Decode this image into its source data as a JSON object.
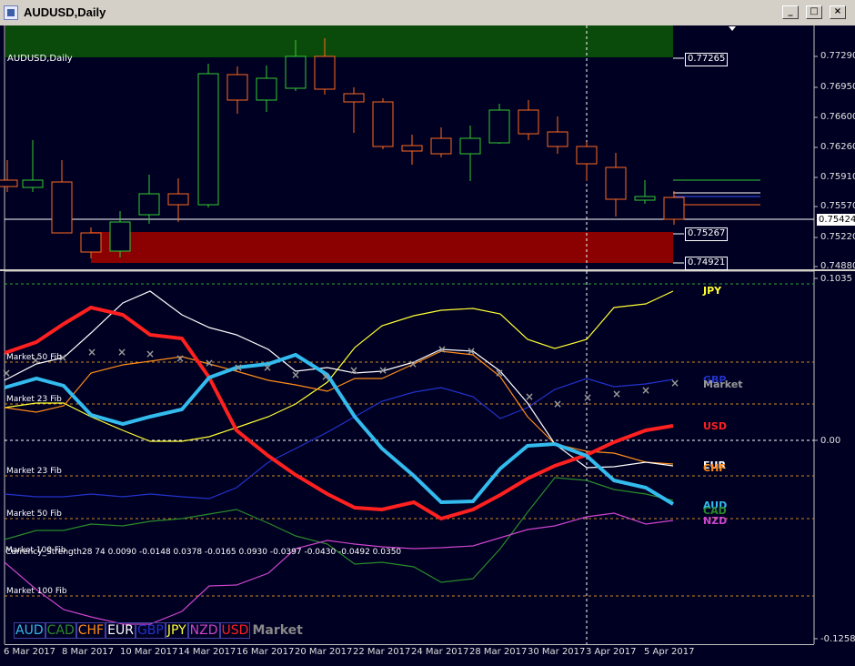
{
  "window": {
    "title": "AUDUSD,Daily",
    "buttons": [
      "_",
      "□",
      "×"
    ]
  },
  "main_chart": {
    "symbol_label": "AUDUSD,Daily",
    "price_axis": [
      "0.77290",
      "0.76950",
      "0.76600",
      "0.76260",
      "0.75910",
      "0.75570",
      "0.75220",
      "0.74880"
    ],
    "price_boxes": {
      "upper": "0.77265",
      "middle": "0.75267",
      "lower": "0.74921"
    },
    "current_price": "0.75424",
    "colors": {
      "bull": "#33cc33",
      "bear": "#ff6a20",
      "supply_zone": "#0a4a0a",
      "demand_zone": "#8b0000",
      "background": "#000022"
    }
  },
  "indicator": {
    "header": "Market 100 Fib",
    "header_overlay": "Currency_Strength28 74 0.0090 -0.0148 0.0378 -0.0165 0.0930 -0.0397 -0.0430 -0.0492 0.0350",
    "axis": {
      "top": "0.1035",
      "zero": "0.00",
      "bottom": "-0.1258"
    },
    "fib_labels": {
      "m50_top": "Market 50 Fib",
      "m23_top": "Market 23 Fib",
      "m23_bot": "Market 23 Fib",
      "m50_bot": "Market 50 Fib",
      "m100_bot": "Market 100 Fib"
    },
    "currency_labels": {
      "jpy": "JPY",
      "gbp": "GBP",
      "market": "Market",
      "usd": "USD",
      "eur": "EUR",
      "chf": "CHF",
      "aud": "AUD",
      "cad": "CAD",
      "nzd": "NZD"
    },
    "legend": [
      "AUD",
      "CAD",
      "CHF",
      "EUR",
      "GBP",
      "JPY",
      "NZD",
      "USD"
    ],
    "legend_market": "Market",
    "colors": {
      "AUD": "#33bbee",
      "CAD": "#2a8a2a",
      "CHF": "#ff8c1a",
      "EUR": "#ffffff",
      "GBP": "#2233cc",
      "JPY": "#ffff33",
      "NZD": "#cc44cc",
      "USD": "#ff2020",
      "Market": "#999999"
    }
  },
  "x_axis": [
    "6 Mar 2017",
    "8 Mar 2017",
    "10 Mar 2017",
    "14 Mar 2017",
    "16 Mar 2017",
    "20 Mar 2017",
    "22 Mar 2017",
    "24 Mar 2017",
    "28 Mar 2017",
    "30 Mar 2017",
    "3 Apr 2017",
    "5 Apr 2017"
  ]
}
